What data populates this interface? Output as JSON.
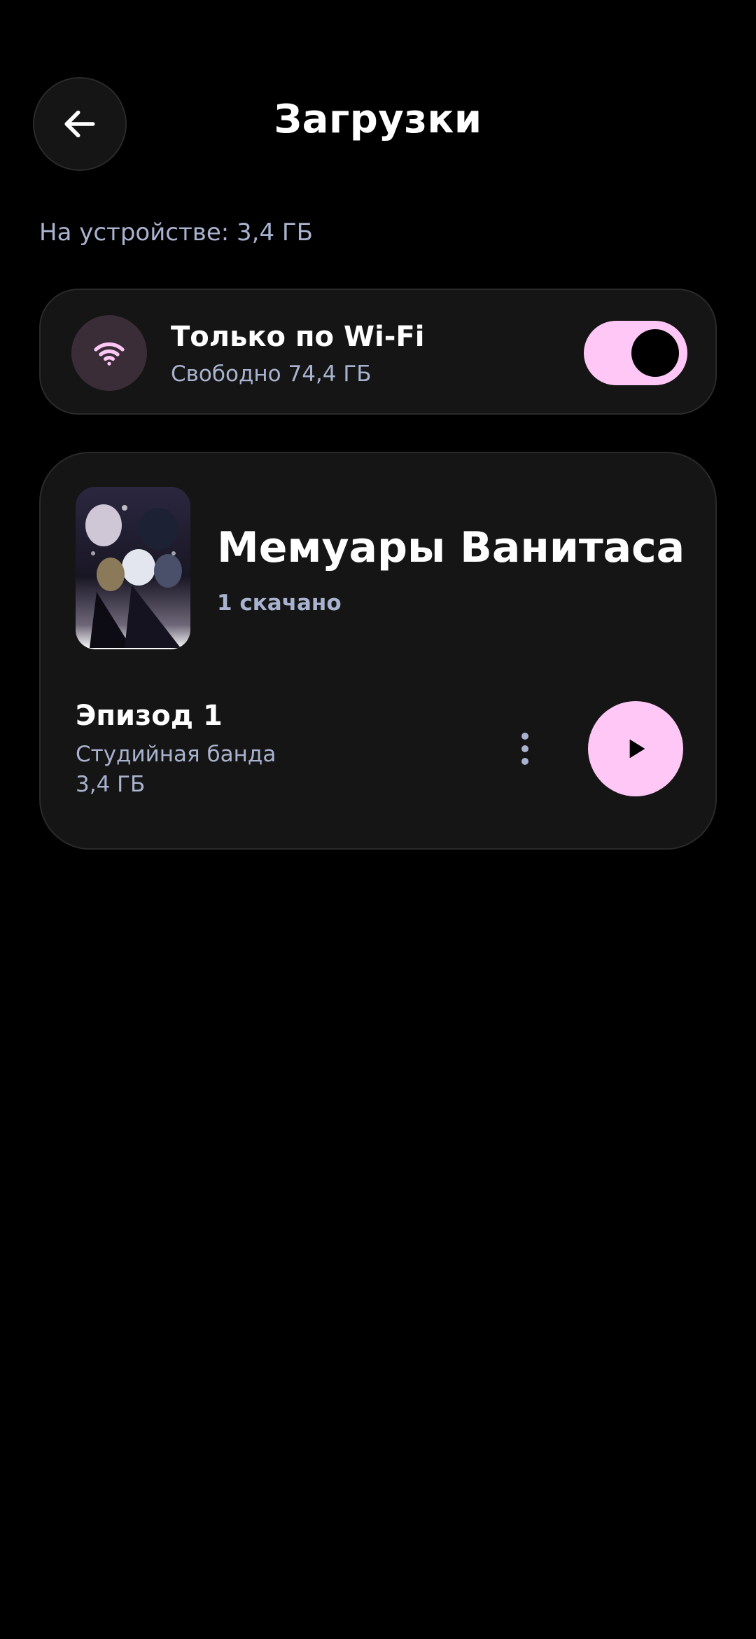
{
  "header": {
    "title": "Загрузки",
    "back_icon": "arrow-left-icon"
  },
  "storage": {
    "label": "На устройстве: 3,4 ГБ"
  },
  "wifi_setting": {
    "icon": "wifi-icon",
    "title": "Только по Wi-Fi",
    "subtitle": "Свободно 74,4 ГБ",
    "enabled": true
  },
  "series": {
    "title": "Мемуары Ванитаса",
    "count_label": "1 скачано",
    "episodes": [
      {
        "title": "Эпизод 1",
        "studio": "Студийная банда",
        "size": "3,4 ГБ",
        "menu_icon": "more-vertical-icon",
        "play_icon": "play-icon"
      }
    ]
  },
  "colors": {
    "background": "#000000",
    "card": "#151515",
    "accent": "#ffc7f5",
    "muted_text": "#a9b3cf",
    "wifi_icon_bg": "#3a2d38"
  }
}
